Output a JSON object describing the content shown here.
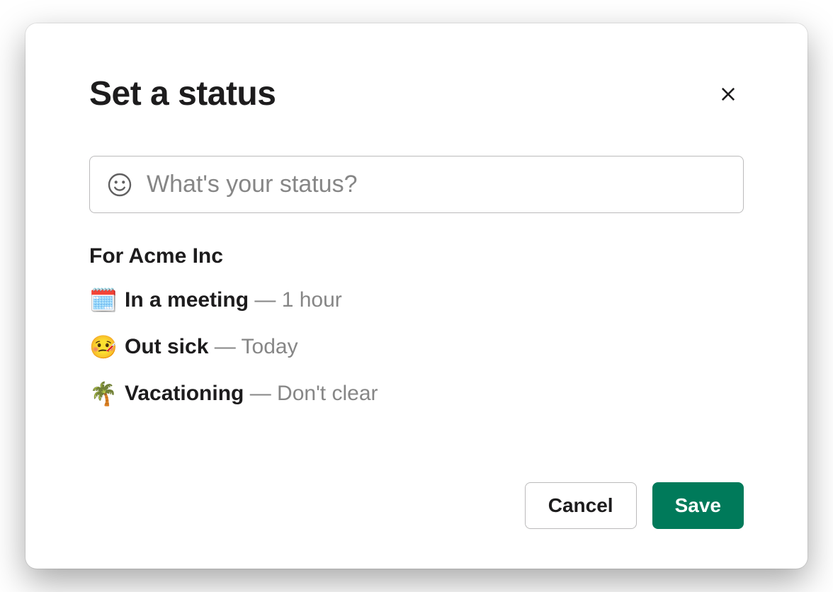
{
  "modal": {
    "title": "Set a status",
    "input": {
      "placeholder": "What's your status?",
      "value": ""
    },
    "section_label": "For Acme Inc",
    "presets": [
      {
        "emoji": "🗓️",
        "label": "In a meeting",
        "duration": "1 hour"
      },
      {
        "emoji": "🤒",
        "label": "Out sick",
        "duration": "Today"
      },
      {
        "emoji": "🌴",
        "label": "Vacationing",
        "duration": "Don't clear"
      }
    ],
    "separator": " — ",
    "buttons": {
      "cancel": "Cancel",
      "save": "Save"
    }
  }
}
